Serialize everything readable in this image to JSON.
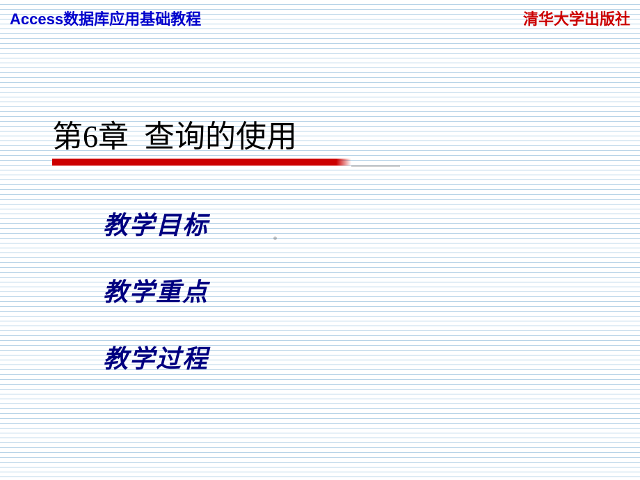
{
  "header": {
    "left": "Access数据库应用基础教程",
    "right": "清华大学出版社"
  },
  "chapter": {
    "title": "第6章  查询的使用"
  },
  "content": {
    "items": [
      "教学目标",
      "教学重点",
      "教学过程"
    ]
  }
}
